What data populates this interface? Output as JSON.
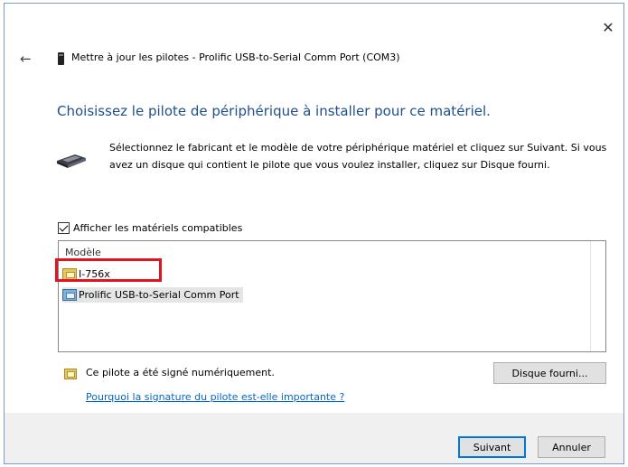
{
  "window": {
    "title": "Mettre à jour les pilotes - Prolific USB-to-Serial Comm Port (COM3)",
    "close_glyph": "✕",
    "back_glyph": "←"
  },
  "main": {
    "heading": "Choisissez le pilote de périphérique à installer pour ce matériel.",
    "description": "Sélectionnez le fabricant et le modèle de votre périphérique matériel et cliquez sur Suivant. Si vous avez un disque qui contient le pilote que vous voulez installer, cliquez sur Disque fourni.",
    "compat_checkbox": {
      "label": "Afficher les matériels compatibles",
      "checked": true
    },
    "list": {
      "column_header": "Modèle",
      "items": [
        {
          "label": "I-756x",
          "icon": "driver-icon",
          "highlighted": true
        },
        {
          "label": "Prolific USB-to-Serial Comm Port",
          "icon": "driver-icon",
          "selected": true
        }
      ]
    },
    "signed_text": "Ce pilote a été signé numériquement.",
    "signature_link": "Pourquoi la signature du pilote est-elle importante ?",
    "disk_button": "Disque fourni..."
  },
  "footer": {
    "next_button": "Suivant",
    "cancel_button": "Annuler"
  },
  "colors": {
    "heading": "#1e4f8c",
    "link": "#0066cc",
    "highlight_box": "#e0141e",
    "default_button_border": "#0078d7"
  }
}
